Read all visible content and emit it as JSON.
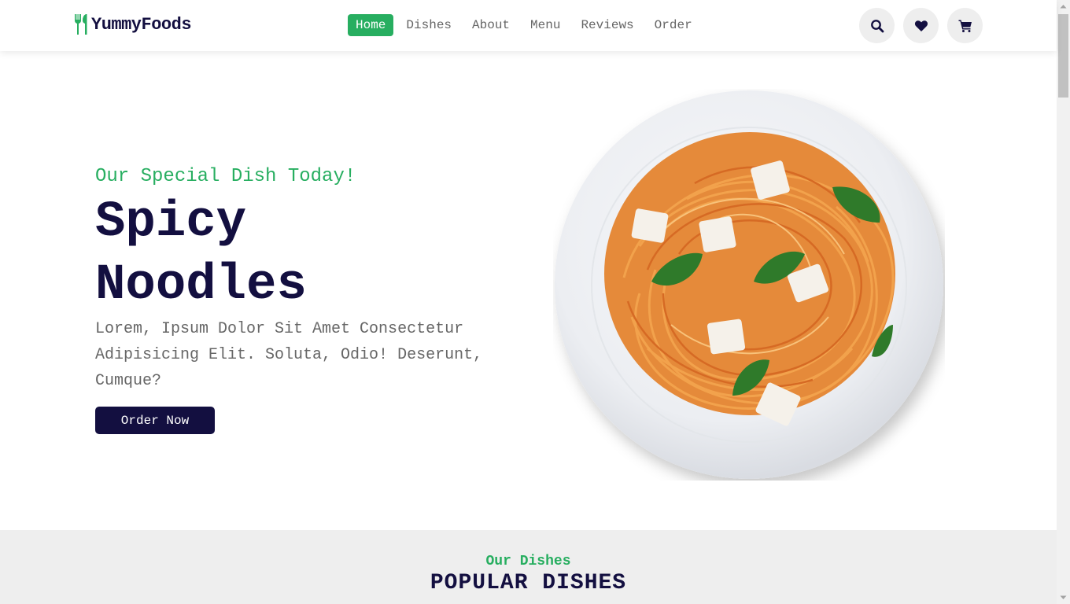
{
  "brand": {
    "name": "YummyFoods"
  },
  "nav": {
    "items": [
      {
        "label": "Home",
        "active": true
      },
      {
        "label": "Dishes"
      },
      {
        "label": "About"
      },
      {
        "label": "Menu"
      },
      {
        "label": "Reviews"
      },
      {
        "label": "Order"
      }
    ]
  },
  "header_icons": [
    "search-icon",
    "heart-icon",
    "cart-icon"
  ],
  "hero": {
    "subtitle": "Our Special Dish Today!",
    "title": "Spicy Noodles",
    "text": "Lorem, Ipsum Dolor Sit Amet Consectetur Adipisicing Elit. Soluta, Odio! Deserunt, Cumque?",
    "button": "Order Now"
  },
  "dishes": {
    "subtitle": "Our Dishes",
    "title": "POPULAR DISHES"
  },
  "colors": {
    "accent": "#27ae60",
    "dark": "#130f40",
    "muted": "#666666",
    "section_bg": "#eeeeee"
  }
}
